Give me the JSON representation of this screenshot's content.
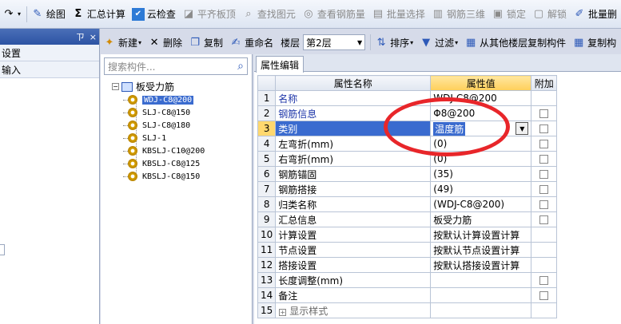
{
  "toolbar": {
    "items": [
      {
        "label": "绘图",
        "icon": "draw-icon",
        "enabled": true
      },
      {
        "label": "汇总计算",
        "icon": "sigma-icon",
        "enabled": true
      },
      {
        "label": "云检查",
        "icon": "cloud-check-icon",
        "enabled": true
      },
      {
        "label": "平齐板顶",
        "icon": "align-top-icon",
        "enabled": false
      },
      {
        "label": "查找图元",
        "icon": "find-icon",
        "enabled": false
      },
      {
        "label": "查看钢筋量",
        "icon": "view-rebar-icon",
        "enabled": false
      },
      {
        "label": "批量选择",
        "icon": "batch-select-icon",
        "enabled": false
      },
      {
        "label": "钢筋三维",
        "icon": "rebar-3d-icon",
        "enabled": false
      },
      {
        "label": "锁定",
        "icon": "lock-icon",
        "enabled": false
      },
      {
        "label": "解锁",
        "icon": "unlock-icon",
        "enabled": false
      },
      {
        "label": "批量删",
        "icon": "batch-delete-icon",
        "enabled": true
      }
    ]
  },
  "left_panel": {
    "pin": "ㄗ",
    "close": "×",
    "rows": [
      "设置",
      "输入"
    ]
  },
  "toolbar2": {
    "new_label": "新建",
    "delete_label": "删除",
    "copy_label": "复制",
    "rename_label": "重命名",
    "floor_label": "楼层",
    "floor_value": "第2层",
    "sort_label": "排序",
    "filter_label": "过滤",
    "copy_from_floor_label": "从其他楼层复制构件",
    "copy_to_label": "复制构"
  },
  "search": {
    "placeholder": "搜索构件..."
  },
  "tree": {
    "root": "板受力筋",
    "children": [
      "WDJ-C8@200",
      "SLJ-C8@150",
      "SLJ-C8@180",
      "SLJ-1",
      "KBSLJ-C10@200",
      "KBSLJ-C8@125",
      "KBSLJ-C8@150"
    ],
    "selected_index": 0
  },
  "property_panel": {
    "tab": "属性编辑",
    "headers": {
      "name": "属性名称",
      "value": "属性值",
      "extra": "附加"
    },
    "rows": [
      {
        "num": "1",
        "name": "名称",
        "value": "WDJ-C8@200",
        "checkbox": false,
        "blue": true
      },
      {
        "num": "2",
        "name": "钢筋信息",
        "value": "Φ8@200",
        "checkbox": true,
        "blue": true
      },
      {
        "num": "3",
        "name": "类别",
        "value": "温度筋",
        "checkbox": true,
        "blue": false
      },
      {
        "num": "4",
        "name": "左弯折(mm)",
        "value": "(0)",
        "checkbox": true,
        "blue": false
      },
      {
        "num": "5",
        "name": "右弯折(mm)",
        "value": "(0)",
        "checkbox": true,
        "blue": false
      },
      {
        "num": "6",
        "name": "钢筋锚固",
        "value": "(35)",
        "checkbox": true,
        "blue": false
      },
      {
        "num": "7",
        "name": "钢筋搭接",
        "value": "(49)",
        "checkbox": true,
        "blue": false
      },
      {
        "num": "8",
        "name": "归类名称",
        "value": "(WDJ-C8@200)",
        "checkbox": true,
        "blue": false
      },
      {
        "num": "9",
        "name": "汇总信息",
        "value": "板受力筋",
        "checkbox": true,
        "blue": false
      },
      {
        "num": "10",
        "name": "计算设置",
        "value": "按默认计算设置计算",
        "checkbox": false,
        "blue": false
      },
      {
        "num": "11",
        "name": "节点设置",
        "value": "按默认节点设置计算",
        "checkbox": false,
        "blue": false
      },
      {
        "num": "12",
        "name": "搭接设置",
        "value": "按默认搭接设置计算",
        "checkbox": false,
        "blue": false
      },
      {
        "num": "13",
        "name": "长度调整(mm)",
        "value": "",
        "checkbox": true,
        "blue": false
      },
      {
        "num": "14",
        "name": "备注",
        "value": "",
        "checkbox": true,
        "blue": false
      },
      {
        "num": "15",
        "name": "显示样式",
        "value": "",
        "checkbox": false,
        "blue": false,
        "expandable": true
      }
    ],
    "selected_row": 2
  },
  "colors": {
    "selection": "#3a6bcf",
    "header_value": "#ffcf5a",
    "annotation": "#e8262a"
  }
}
